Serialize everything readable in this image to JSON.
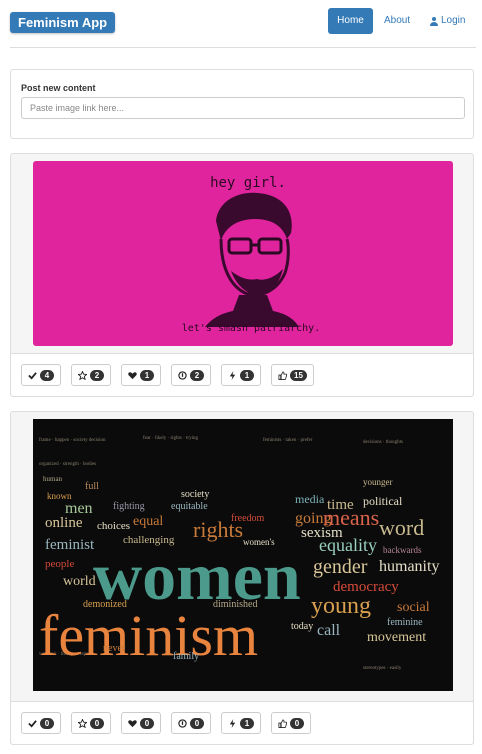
{
  "brand": "Feminism App",
  "nav": {
    "home": "Home",
    "about": "About",
    "login": "Login"
  },
  "post": {
    "label": "Post new content",
    "placeholder": "Paste image link here..."
  },
  "posts": [
    {
      "image_alt_text": "hey girl. let's smash patriarchy.",
      "image_top_text": "hey girl.",
      "image_bottom_text": "let's smash patriarchy.",
      "image_bg": "#e0249e",
      "reactions": [
        {
          "icon": "check-icon",
          "count": "4"
        },
        {
          "icon": "star-icon",
          "count": "2"
        },
        {
          "icon": "heart-icon",
          "count": "1"
        },
        {
          "icon": "circle-icon",
          "count": "2"
        },
        {
          "icon": "bolt-icon",
          "count": "1"
        },
        {
          "icon": "thumbs-up-icon",
          "count": "15"
        }
      ]
    },
    {
      "image_bg": "#0b0b0b",
      "words": {
        "women": "women",
        "feminism": "feminism",
        "gender": "gender",
        "humanity": "humanity",
        "rights": "rights",
        "equality": "equality",
        "young": "young",
        "sexism": "sexism",
        "men": "men",
        "online": "online",
        "feminist": "feminist",
        "world": "world",
        "means": "means",
        "word": "word",
        "time": "time",
        "political": "political",
        "democracy": "democracy",
        "movement": "movement",
        "call": "call",
        "social": "social",
        "people": "people",
        "choices": "choices",
        "equal": "equal",
        "challenging": "challenging",
        "fighting": "fighting",
        "demonized": "demonized",
        "diminished": "diminished",
        "society": "society",
        "media": "media",
        "freedom": "freedom",
        "feminine": "feminine",
        "family": "family",
        "never": "never",
        "today": "today",
        "going": "going",
        "backwards": "backwards",
        "younger": "younger",
        "women_s": "women's",
        "full": "full",
        "human": "human",
        "known": "known",
        "equitable": "equitable"
      },
      "reactions": [
        {
          "icon": "check-icon",
          "count": "0"
        },
        {
          "icon": "star-icon",
          "count": "0"
        },
        {
          "icon": "heart-icon",
          "count": "0"
        },
        {
          "icon": "circle-icon",
          "count": "0"
        },
        {
          "icon": "bolt-icon",
          "count": "1"
        },
        {
          "icon": "thumbs-up-icon",
          "count": "0"
        }
      ]
    }
  ],
  "colors": {
    "primary": "#337ab7",
    "badge": "#333333",
    "border": "#dddddd"
  }
}
